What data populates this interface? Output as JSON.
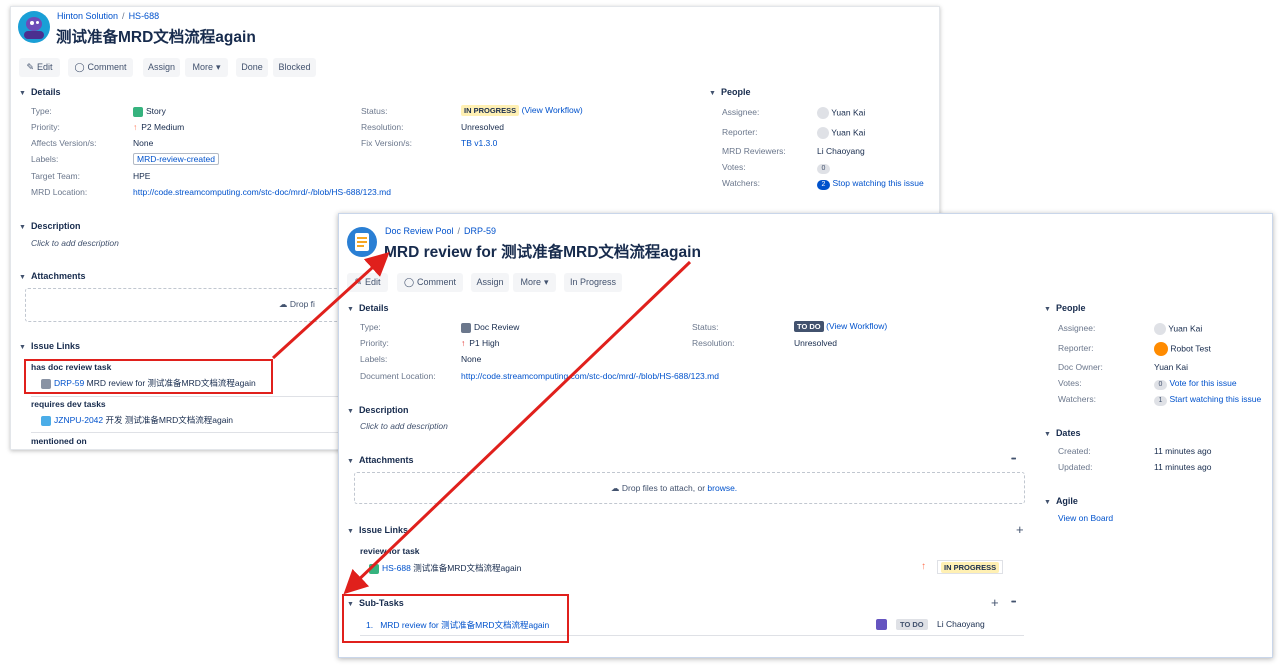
{
  "win1": {
    "breadcrumb": {
      "project": "Hinton Solution",
      "sep": "/",
      "key": "HS-688"
    },
    "title": "测试准备MRD文档流程again",
    "toolbar": {
      "edit": "Edit",
      "comment": "Comment",
      "assign": "Assign",
      "more": "More",
      "done": "Done",
      "blocked": "Blocked"
    },
    "details": {
      "heading": "Details",
      "type_label": "Type:",
      "type_value": "Story",
      "priority_label": "Priority:",
      "priority_value": "P2 Medium",
      "affects_label": "Affects Version/s:",
      "affects_value": "None",
      "labels_label": "Labels:",
      "labels_value": "MRD-review-created",
      "team_label": "Target Team:",
      "team_value": "HPE",
      "mrd_label": "MRD Location:",
      "mrd_value": "http://code.streamcomputing.com/stc-doc/mrd/-/blob/HS-688/123.md",
      "status_label": "Status:",
      "status_value": "IN PROGRESS",
      "workflow": "(View Workflow)",
      "resolution_label": "Resolution:",
      "resolution_value": "Unresolved",
      "fix_label": "Fix Version/s:",
      "fix_value": "TB v1.3.0"
    },
    "people": {
      "heading": "People",
      "assignee_label": "Assignee:",
      "assignee_value": "Yuan Kai",
      "reporter_label": "Reporter:",
      "reporter_value": "Yuan Kai",
      "reviewers_label": "MRD Reviewers:",
      "reviewers_value": "Li Chaoyang",
      "votes_label": "Votes:",
      "votes_value": "0",
      "watchers_label": "Watchers:",
      "watchers_count": "2",
      "watchers_value": "Stop watching this issue"
    },
    "description": {
      "heading": "Description",
      "placeholder": "Click to add description"
    },
    "attachments": {
      "heading": "Attachments",
      "drop": "Drop fi"
    },
    "links": {
      "heading": "Issue Links",
      "group1": "has doc review task",
      "item1_key": "DRP-59",
      "item1_text": "MRD review for 测试准备MRD文档流程again",
      "group2": "requires dev tasks",
      "item2_key": "JZNPU-2042",
      "item2_text": "开发 测试准备MRD文档流程again",
      "group3": "mentioned on"
    }
  },
  "win2": {
    "breadcrumb": {
      "project": "Doc Review Pool",
      "sep": "/",
      "key": "DRP-59"
    },
    "title": "MRD review for 测试准备MRD文档流程again",
    "toolbar": {
      "edit": "Edit",
      "comment": "Comment",
      "assign": "Assign",
      "more": "More",
      "progress": "In Progress"
    },
    "details": {
      "heading": "Details",
      "type_label": "Type:",
      "type_value": "Doc Review",
      "priority_label": "Priority:",
      "priority_value": "P1 High",
      "labels_label": "Labels:",
      "labels_value": "None",
      "doc_label": "Document Location:",
      "doc_value": "http://code.streamcomputing.com/stc-doc/mrd/-/blob/HS-688/123.md",
      "status_label": "Status:",
      "status_value": "TO DO",
      "workflow": "(View Workflow)",
      "resolution_label": "Resolution:",
      "resolution_value": "Unresolved"
    },
    "people": {
      "heading": "People",
      "assignee_label": "Assignee:",
      "assignee_value": "Yuan Kai",
      "reporter_label": "Reporter:",
      "reporter_value": "Robot Test",
      "owner_label": "Doc Owner:",
      "owner_value": "Yuan Kai",
      "votes_label": "Votes:",
      "votes_count": "0",
      "votes_value": "Vote for this issue",
      "watchers_label": "Watchers:",
      "watchers_count": "1",
      "watchers_value": "Start watching this issue"
    },
    "dates": {
      "heading": "Dates",
      "created_label": "Created:",
      "created_value": "11 minutes ago",
      "updated_label": "Updated:",
      "updated_value": "11 minutes ago"
    },
    "agile": {
      "heading": "Agile",
      "link": "View on Board"
    },
    "description": {
      "heading": "Description",
      "placeholder": "Click to add description"
    },
    "attachments": {
      "heading": "Attachments",
      "drop_text": "Drop files to attach, or",
      "browse": "browse."
    },
    "links": {
      "heading": "Issue Links",
      "group1": "review for task",
      "item1_key": "HS-688",
      "item1_text": "测试准备MRD文档流程again",
      "item1_status": "IN PROGRESS"
    },
    "subtasks": {
      "heading": "Sub-Tasks",
      "index": "1.",
      "item1_text": "MRD review for 测试准备MRD文档流程again",
      "item1_status": "TO DO",
      "item1_assignee": "Li Chaoyang"
    },
    "ellipsis": "•••",
    "plus": "+"
  },
  "colors": {
    "annotation": "#e0201c",
    "link": "#0052cc",
    "in_progress": "#fff0b3",
    "todo": "#42526e"
  }
}
